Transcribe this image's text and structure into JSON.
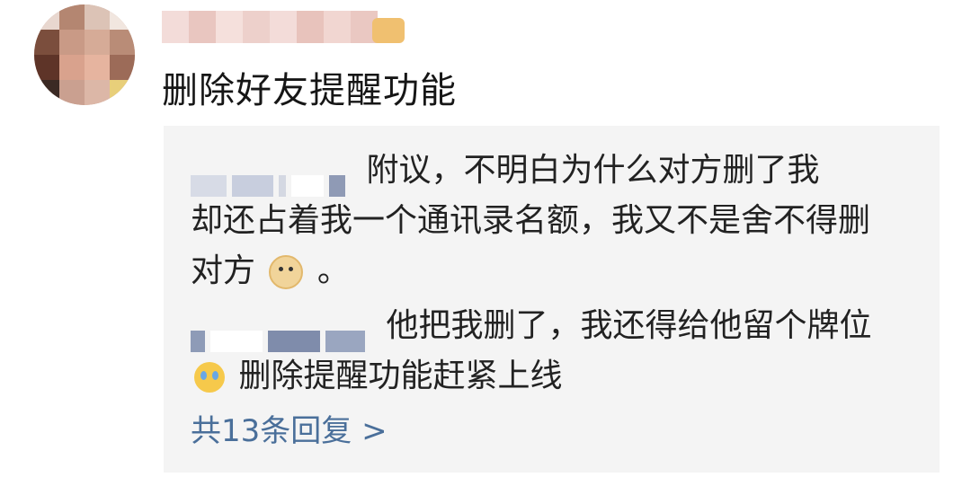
{
  "post": {
    "text": "删除好友提醒功能",
    "avatar_icon": "avatar-pixelated",
    "username_icon": "blurred-username"
  },
  "replies": [
    {
      "text_line1": "附议，不明白为什么对方删了我",
      "text_line2": "却还占着我一个通讯录名额，我又不是舍不得删",
      "text_line3": "对方",
      "text_end": "。",
      "emoji": "doge-icon"
    },
    {
      "text_line1": "他把我删了，我还得给他留个牌位",
      "text_line2": "删除提醒功能赶紧上线",
      "emoji": "crying-face-icon"
    }
  ],
  "more_replies": "共13条回复 >",
  "colors": {
    "reply_bg": "#f4f4f4",
    "link": "#4a6f9a"
  }
}
